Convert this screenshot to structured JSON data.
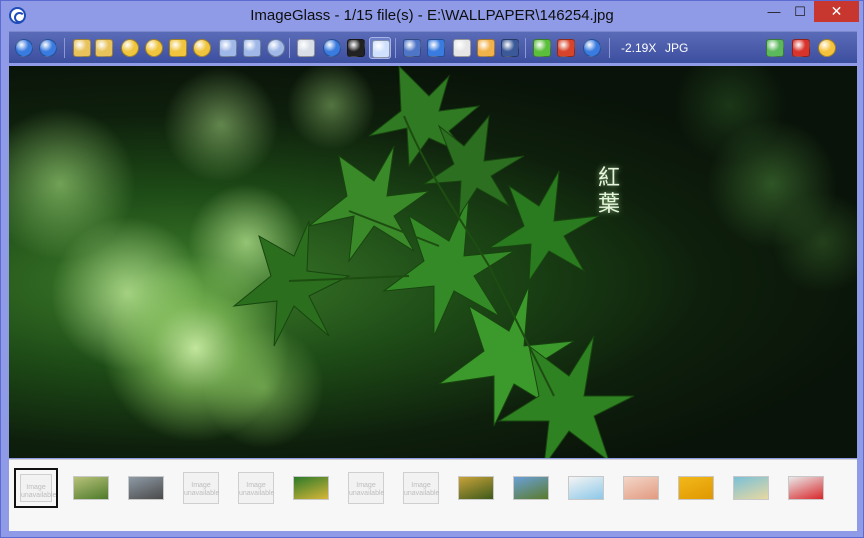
{
  "window": {
    "title": "ImageGlass - 1/15 file(s) - E:\\WALLPAPER\\146254.jpg",
    "minimize_glyph": "—",
    "maximize_glyph": "☐",
    "close_glyph": "✕"
  },
  "toolbar": {
    "zoom_readout": "-2.19X",
    "format_readout": "JPG",
    "buttons": [
      {
        "name": "back-arrow-icon",
        "color": "#3a7be0"
      },
      {
        "name": "forward-arrow-icon",
        "color": "#3a7be0"
      },
      {
        "name": "rotate-left-icon",
        "color": "#e8c25a"
      },
      {
        "name": "rotate-right-icon",
        "color": "#e8c25a"
      },
      {
        "name": "zoom-in-icon",
        "color": "#f0c43c"
      },
      {
        "name": "zoom-out-icon",
        "color": "#f0c43c"
      },
      {
        "name": "actual-size-icon",
        "color": "#f0c43c"
      },
      {
        "name": "zoom-lock-icon",
        "color": "#f0c43c"
      },
      {
        "name": "scale-width-icon",
        "color": "#9fb8e8"
      },
      {
        "name": "scale-height-icon",
        "color": "#9fb8e8"
      },
      {
        "name": "auto-zoom-icon",
        "color": "#9fb8e8"
      },
      {
        "name": "open-folder-icon",
        "color": "#d9dde6"
      },
      {
        "name": "refresh-icon",
        "color": "#3a7be0"
      },
      {
        "name": "go-to-image-icon",
        "color": "#222222"
      },
      {
        "name": "thumbnail-toggle-icon",
        "color": "#cfe0ff"
      },
      {
        "name": "checkerboard-icon",
        "color": "#4f75c7"
      },
      {
        "name": "edit-image-icon",
        "color": "#3a7be0"
      },
      {
        "name": "fullscreen-icon",
        "color": "#e6e6e6"
      },
      {
        "name": "slideshow-icon",
        "color": "#f2b24a"
      },
      {
        "name": "facebook-upload-icon",
        "color": "#3b5998"
      },
      {
        "name": "plugin-icon",
        "color": "#5cbf3c"
      },
      {
        "name": "delete-icon",
        "color": "#d8442b"
      },
      {
        "name": "help-icon",
        "color": "#3a7be0"
      },
      {
        "name": "like-icon",
        "color": "#5cb85c"
      },
      {
        "name": "dislike-icon",
        "color": "#d9342b"
      },
      {
        "name": "report-icon",
        "color": "#f5c33b"
      }
    ]
  },
  "viewer": {
    "caption": [
      "紅",
      "葉"
    ]
  },
  "thumbnails": [
    {
      "kind": "no-image",
      "text": "Image\nunavailable",
      "selected": true
    },
    {
      "kind": "photo",
      "colors": [
        "#b8c27a",
        "#4d7a2a"
      ]
    },
    {
      "kind": "photo",
      "colors": [
        "#8e9aa6",
        "#4a4a4a"
      ]
    },
    {
      "kind": "no-image",
      "text": "Image\nunavailable"
    },
    {
      "kind": "no-image",
      "text": "Image\nunavailable"
    },
    {
      "kind": "photo",
      "colors": [
        "#2c7a2a",
        "#d8b638"
      ]
    },
    {
      "kind": "no-image",
      "text": "Image\nunavailable"
    },
    {
      "kind": "no-image",
      "text": "Image\nunavailable"
    },
    {
      "kind": "photo",
      "colors": [
        "#c8a23a",
        "#3d5a1a"
      ]
    },
    {
      "kind": "photo",
      "colors": [
        "#6aa0d8",
        "#5a7a2a"
      ]
    },
    {
      "kind": "photo",
      "colors": [
        "#f4f4f4",
        "#8cc8e8"
      ]
    },
    {
      "kind": "photo",
      "colors": [
        "#f3d6c8",
        "#e29a80"
      ]
    },
    {
      "kind": "photo",
      "colors": [
        "#f2b81a",
        "#e09800"
      ]
    },
    {
      "kind": "photo",
      "colors": [
        "#7ac0d8",
        "#e8d8a0"
      ]
    },
    {
      "kind": "photo",
      "colors": [
        "#e9e9e9",
        "#d8262a"
      ]
    }
  ]
}
